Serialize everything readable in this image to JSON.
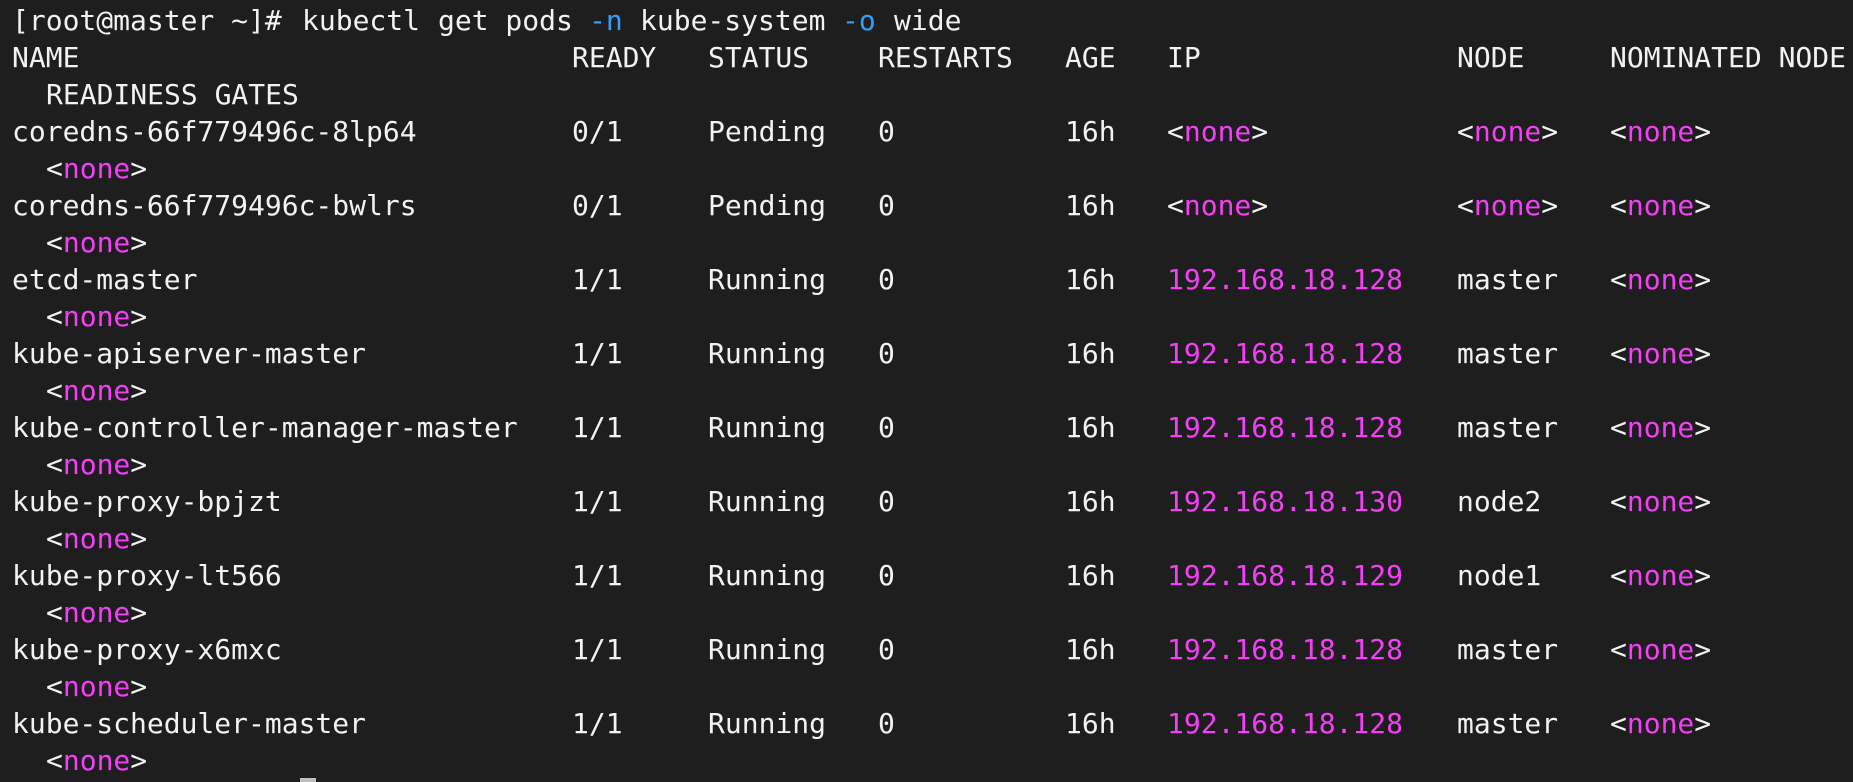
{
  "terminal": {
    "colors": {
      "background": "#1e1e1e",
      "text": "#f2f2f2",
      "highlight": "#f53ef8",
      "flag": "#2f9fff"
    },
    "prompt": {
      "text": "[root@master ~]#",
      "command": "kubectl",
      "subcommand": "get pods",
      "flag_n": "-n",
      "namespace": "kube-system",
      "flag_o": "-o",
      "output": "wide"
    },
    "headers": {
      "name": "NAME",
      "ready": "READY",
      "status": "STATUS",
      "restarts": "RESTARTS",
      "age": "AGE",
      "ip": "IP",
      "node": "NODE",
      "nominated": "NOMINATED NODE",
      "readiness": "READINESS GATES"
    },
    "rows": [
      {
        "name": "coredns-66f779496c-8lp64",
        "ready": "0/1",
        "status": "Pending",
        "restarts": "0",
        "age": "16h",
        "ip": "none",
        "ip_is_none": true,
        "node": "none",
        "node_is_none": true,
        "nominated": "none",
        "readiness": "none"
      },
      {
        "name": "coredns-66f779496c-bwlrs",
        "ready": "0/1",
        "status": "Pending",
        "restarts": "0",
        "age": "16h",
        "ip": "none",
        "ip_is_none": true,
        "node": "none",
        "node_is_none": true,
        "nominated": "none",
        "readiness": "none"
      },
      {
        "name": "etcd-master",
        "ready": "1/1",
        "status": "Running",
        "restarts": "0",
        "age": "16h",
        "ip": "192.168.18.128",
        "ip_is_none": false,
        "node": "master",
        "node_is_none": false,
        "nominated": "none",
        "readiness": "none"
      },
      {
        "name": "kube-apiserver-master",
        "ready": "1/1",
        "status": "Running",
        "restarts": "0",
        "age": "16h",
        "ip": "192.168.18.128",
        "ip_is_none": false,
        "node": "master",
        "node_is_none": false,
        "nominated": "none",
        "readiness": "none"
      },
      {
        "name": "kube-controller-manager-master",
        "ready": "1/1",
        "status": "Running",
        "restarts": "0",
        "age": "16h",
        "ip": "192.168.18.128",
        "ip_is_none": false,
        "node": "master",
        "node_is_none": false,
        "nominated": "none",
        "readiness": "none"
      },
      {
        "name": "kube-proxy-bpjzt",
        "ready": "1/1",
        "status": "Running",
        "restarts": "0",
        "age": "16h",
        "ip": "192.168.18.130",
        "ip_is_none": false,
        "node": "node2",
        "node_is_none": false,
        "nominated": "none",
        "readiness": "none"
      },
      {
        "name": "kube-proxy-lt566",
        "ready": "1/1",
        "status": "Running",
        "restarts": "0",
        "age": "16h",
        "ip": "192.168.18.129",
        "ip_is_none": false,
        "node": "node1",
        "node_is_none": false,
        "nominated": "none",
        "readiness": "none"
      },
      {
        "name": "kube-proxy-x6mxc",
        "ready": "1/1",
        "status": "Running",
        "restarts": "0",
        "age": "16h",
        "ip": "192.168.18.128",
        "ip_is_none": false,
        "node": "master",
        "node_is_none": false,
        "nominated": "none",
        "readiness": "none"
      },
      {
        "name": "kube-scheduler-master",
        "ready": "1/1",
        "status": "Running",
        "restarts": "0",
        "age": "16h",
        "ip": "192.168.18.128",
        "ip_is_none": false,
        "node": "master",
        "node_is_none": false,
        "nominated": "none",
        "readiness": "none"
      }
    ]
  }
}
